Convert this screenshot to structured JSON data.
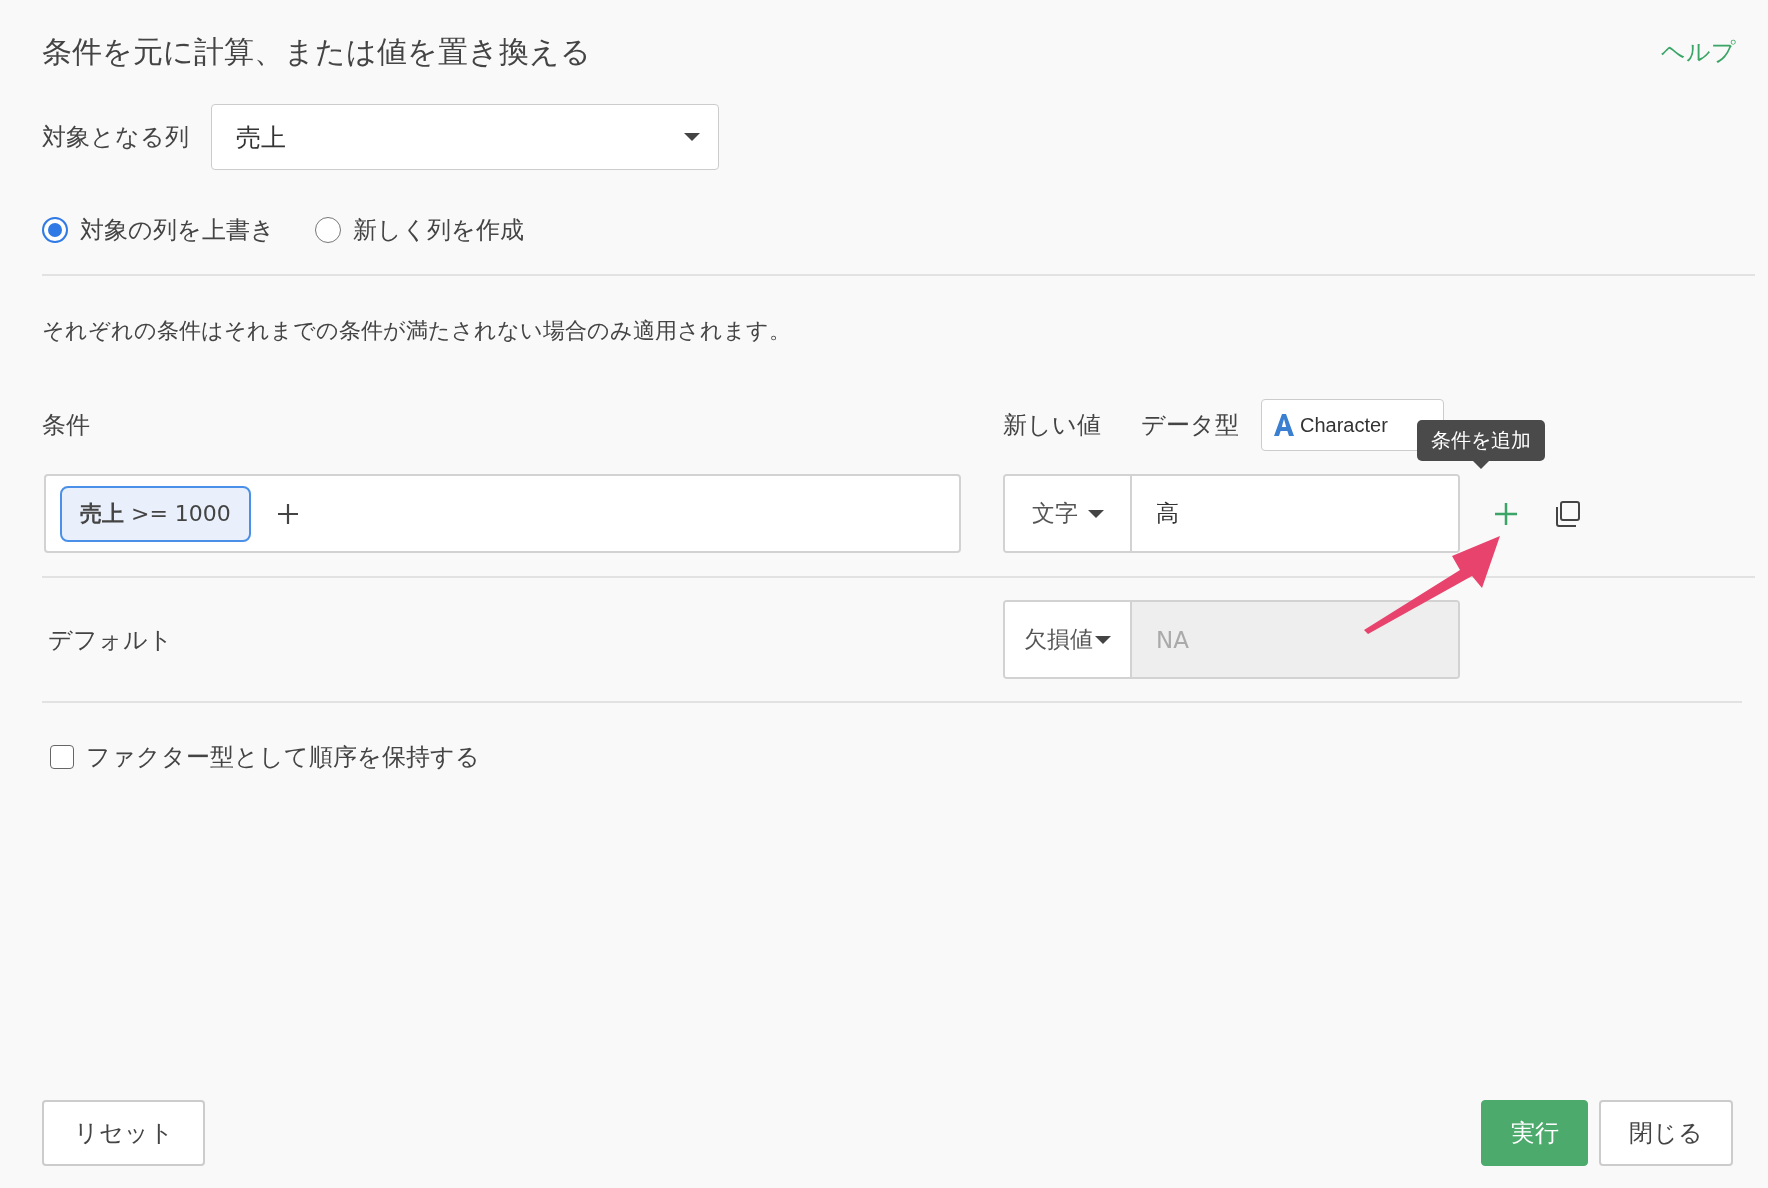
{
  "title": "条件を元に計算、または値を置き換える",
  "help_link": "ヘルプ",
  "target_column": {
    "label": "対象となる列",
    "value": "売上"
  },
  "mode_options": [
    {
      "label": "対象の列を上書き",
      "selected": true
    },
    {
      "label": "新しく列を作成",
      "selected": false
    }
  ],
  "note": "それぞれの条件はそれまでの条件が満たされない場合のみ適用されます。",
  "conditions_header": {
    "label": "条件",
    "new_value_label": "新しい値",
    "data_type_label": "データ型",
    "data_type": "Character"
  },
  "conditions": [
    {
      "chip": "**売上** >= 1000",
      "value_type": "文字",
      "value": "高"
    }
  ],
  "tooltip": "条件を追加",
  "default": {
    "label": "デフォルト",
    "value_type": "欠損値",
    "placeholder": "NA",
    "disabled": true
  },
  "keep_factor": {
    "label": "ファクター型として順序を保持する",
    "checked": false
  },
  "buttons": [
    {
      "label": "リセット",
      "kind": "reset"
    },
    {
      "label": "実行",
      "kind": "primary"
    },
    {
      "label": "閉じる",
      "kind": "secondary"
    }
  ]
}
